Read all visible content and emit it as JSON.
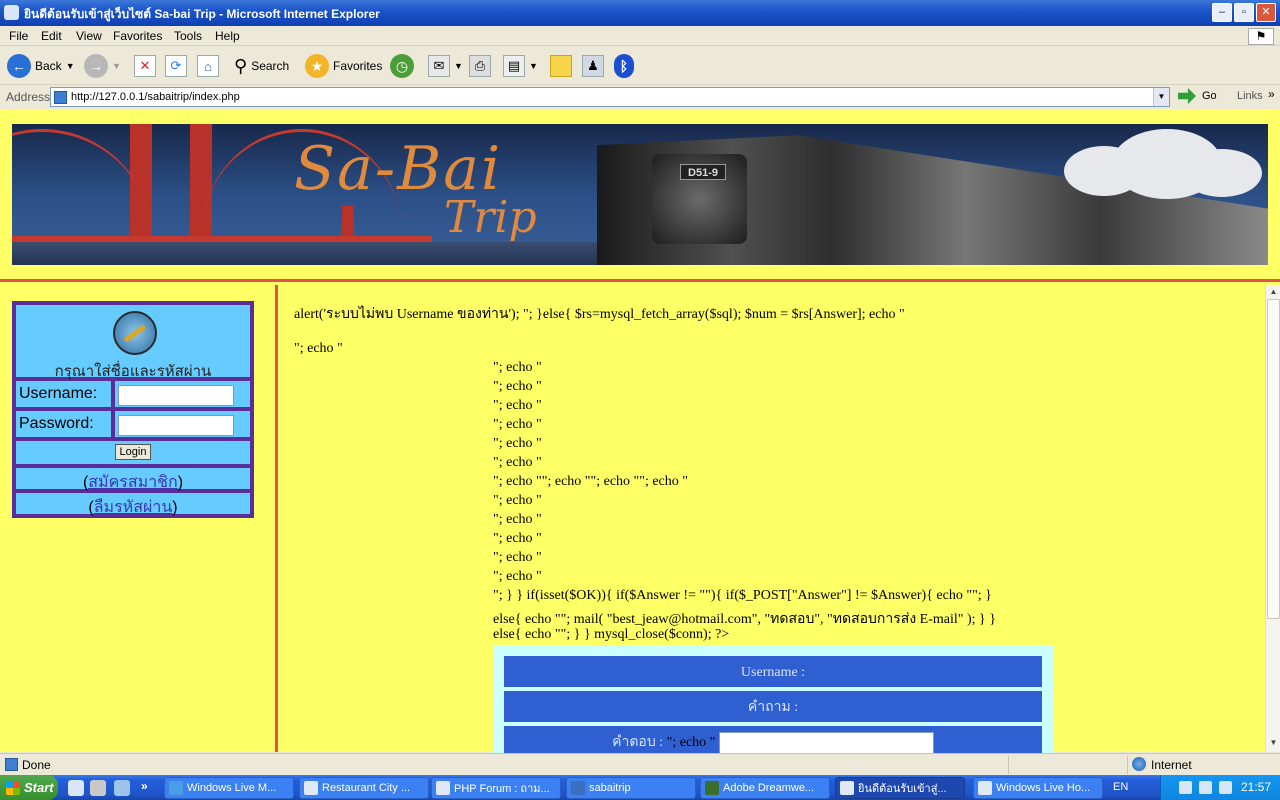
{
  "window": {
    "title": "ยินดีต้อนรับเข้าสู่เว็บไซต์ Sa-bai Trip - Microsoft Internet Explorer",
    "min": "–",
    "max": "▫",
    "close": "✕"
  },
  "menu": [
    "File",
    "Edit",
    "View",
    "Favorites",
    "Tools",
    "Help"
  ],
  "toolbar": {
    "back": "Back",
    "search": "Search",
    "favorites": "Favorites"
  },
  "address": {
    "label": "Address",
    "url": "http://127.0.0.1/sabaitrip/index.php",
    "go": "Go",
    "links": "Links"
  },
  "banner": {
    "logo_line1": "Sa-Bai",
    "logo_line2": "Trip",
    "plate": "D51-9"
  },
  "login": {
    "prompt": "กรุณาใส่ชื่อและรหัสผ่าน",
    "username_label": "Username:",
    "password_label": "Password:",
    "button": "Login",
    "register_link": "สมัครสมาชิก",
    "forgot_link": "ลืมรหัสผ่าน",
    "paren_open": "(",
    "paren_close": ")"
  },
  "main": {
    "line1": "alert('ระบบไม่พบ Username ของท่าน'); \"; }else{ $rs=mysql_fetch_array($sql); $num = $rs[Answer]; echo \"",
    "line2": "\"; echo \"",
    "echo_lines": [
      "\"; echo \"",
      "\"; echo \"",
      "\"; echo \"",
      "\"; echo \"",
      "\"; echo \"",
      "\"; echo \"",
      "\"; echo \"\"; echo \"\"; echo \"\"; echo \"",
      "\"; echo \"",
      "\"; echo \"",
      "\"; echo \"",
      "\"; echo \"",
      "\"; echo \""
    ],
    "code1": "\"; } } if(isset($OK)){ if($Answer != \"\"){ if($_POST[\"Answer\"] != $Answer){ echo \"\"; }",
    "code2": "else{ echo \"\"; mail( \"best_jeaw@hotmail.com\", \"ทดสอบ\", \"ทดสอบการส่ง E-mail\" ); } }",
    "code3": "else{ echo \"\"; } } mysql_close($conn); ?>",
    "box": {
      "username_row": "Username :",
      "question_row": "คำถาม :",
      "answer_label": "คำตอบ :",
      "answer_tail": "\"; echo \""
    }
  },
  "status": {
    "text": "Done",
    "zone": "Internet"
  },
  "taskbar": {
    "start": "Start",
    "more": "»",
    "tasks": [
      {
        "label": "Windows Live M...",
        "color": "#4a9be8"
      },
      {
        "label": "Restaurant City ...",
        "color": "#e0e8f4"
      },
      {
        "label": "PHP Forum : ถาม...",
        "color": "#e0e8f4"
      },
      {
        "label": "sabaitrip",
        "color": "#3a6fbf"
      },
      {
        "label": "Adobe Dreamwe...",
        "color": "#3a6e2a"
      },
      {
        "label": "ยินดีต้อนรับเข้าสู่...",
        "color": "#e0e8f4"
      },
      {
        "label": "Windows Live Ho...",
        "color": "#e0e8f4"
      }
    ],
    "lang": "EN",
    "clock": "21:57"
  },
  "colors": {
    "page_bg": "#ffff66",
    "divider": "#e25050",
    "login_border": "#5a2d9a",
    "login_cell": "#66ccff",
    "box_row": "#2f5fd1"
  }
}
